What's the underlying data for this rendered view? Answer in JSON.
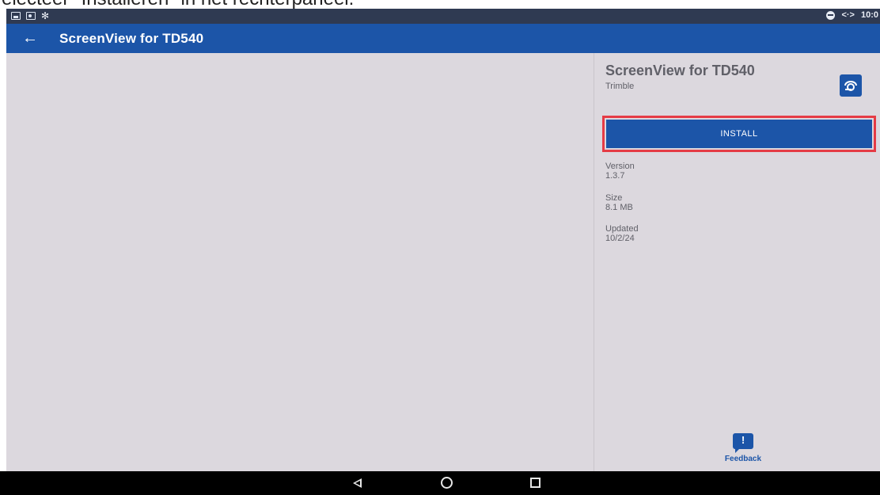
{
  "caption": "electeer \"Installeren\" in het rechterpaneel.",
  "status_bar": {
    "time": "10:0",
    "data_icon": "<·>"
  },
  "app_bar": {
    "back_icon": "←",
    "title": "ScreenView for TD540"
  },
  "panel": {
    "app_name": "ScreenView for TD540",
    "publisher": "Trimble",
    "install_label": "INSTALL",
    "details": [
      {
        "label": "Version",
        "value": "1.3.7"
      },
      {
        "label": "Size",
        "value": "8.1 MB"
      },
      {
        "label": "Updated",
        "value": "10/2/24"
      }
    ],
    "feedback_label": "Feedback",
    "feedback_icon": "!"
  },
  "colors": {
    "accent": "#1c55a8",
    "highlight": "#e53b45",
    "surface": "#dcd8de"
  }
}
